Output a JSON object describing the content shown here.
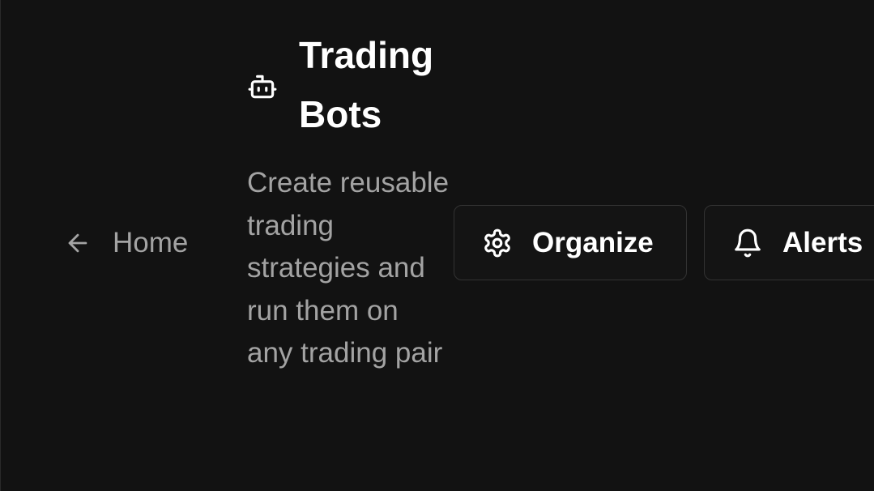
{
  "nav": {
    "back_label": "Home",
    "back_icon": "arrow-left-icon"
  },
  "header": {
    "icon": "bot-icon",
    "title": "Trading Bots",
    "subtitle": "Create reusable trading strategies and run them on any trading pair"
  },
  "actions": {
    "organize_label": "Organize",
    "organize_icon": "gear-icon",
    "alerts_label": "Alerts",
    "alerts_icon": "bell-icon"
  },
  "colors": {
    "background": "#121212",
    "text_primary": "#ffffff",
    "text_secondary": "#a3a3a3",
    "border": "#333333"
  }
}
